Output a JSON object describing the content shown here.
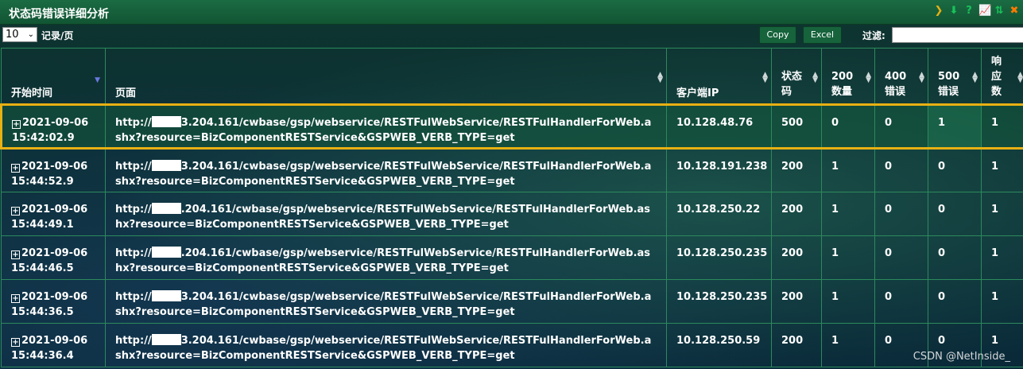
{
  "window": {
    "title": "状态码错误详细分析",
    "tools": [
      {
        "icon": "chevron-right-icon",
        "glyph": "❯",
        "color": "#e8b013"
      },
      {
        "icon": "download-icon",
        "glyph": "⬇",
        "color": "#19c25a"
      },
      {
        "icon": "help-icon",
        "glyph": "?",
        "color": "#19c25a"
      },
      {
        "icon": "line-chart-icon",
        "glyph": "📈",
        "color": "#19c25a"
      },
      {
        "icon": "sort-icon",
        "glyph": "⇅",
        "color": "#19c25a"
      },
      {
        "icon": "close-icon",
        "glyph": "✖",
        "color": "#ff7a00"
      }
    ]
  },
  "toolbar": {
    "page_size": "10",
    "per_page_label": "记录/页",
    "copy_label": "Copy",
    "excel_label": "Excel",
    "filter_label": "过滤:",
    "filter_value": ""
  },
  "table": {
    "columns": [
      {
        "key": "start_time",
        "label": "开始时间",
        "sort": "desc"
      },
      {
        "key": "page",
        "label": "页面",
        "sort": "both"
      },
      {
        "key": "client_ip",
        "label": "客户端IP",
        "sort": "both"
      },
      {
        "key": "status_code",
        "label": "状态码",
        "sort": "both"
      },
      {
        "key": "count_200",
        "label": "200数量",
        "sort": "both"
      },
      {
        "key": "err_400",
        "label": "400错误",
        "sort": "both"
      },
      {
        "key": "err_500",
        "label": "500错误",
        "sort": "both"
      },
      {
        "key": "resp_count",
        "label": "响应数",
        "sort": "both"
      }
    ],
    "rows": [
      {
        "date": "2021-09-06",
        "time": "15:42:02.9",
        "url_prefix": "http://",
        "url_rest": "3.204.161/cwbase/gsp/webservice/RESTFulWebService/RESTFulHandlerForWeb.ashx?resource=BizComponentRESTService&GSPWEB_VERB_TYPE=get",
        "client_ip": "10.128.48.76",
        "status_code": "500",
        "count_200": "0",
        "err_400": "0",
        "err_500": "1",
        "resp_count": "1",
        "selected": true
      },
      {
        "date": "2021-09-06",
        "time": "15:44:52.9",
        "url_prefix": "http://",
        "url_rest": "3.204.161/cwbase/gsp/webservice/RESTFulWebService/RESTFulHandlerForWeb.ashx?resource=BizComponentRESTService&GSPWEB_VERB_TYPE=get",
        "client_ip": "10.128.191.238",
        "status_code": "200",
        "count_200": "1",
        "err_400": "0",
        "err_500": "0",
        "resp_count": "1"
      },
      {
        "date": "2021-09-06",
        "time": "15:44:49.1",
        "url_prefix": "http://",
        "url_rest": ".204.161/cwbase/gsp/webservice/RESTFulWebService/RESTFulHandlerForWeb.ashx?resource=BizComponentRESTService&GSPWEB_VERB_TYPE=get",
        "client_ip": "10.128.250.22",
        "status_code": "200",
        "count_200": "1",
        "err_400": "0",
        "err_500": "0",
        "resp_count": "1"
      },
      {
        "date": "2021-09-06",
        "time": "15:44:46.5",
        "url_prefix": "http://",
        "url_rest": ".204.161/cwbase/gsp/webservice/RESTFulWebService/RESTFulHandlerForWeb.ashx?resource=BizComponentRESTService&GSPWEB_VERB_TYPE=get",
        "client_ip": "10.128.250.235",
        "status_code": "200",
        "count_200": "1",
        "err_400": "0",
        "err_500": "0",
        "resp_count": "1"
      },
      {
        "date": "2021-09-06",
        "time": "15:44:36.5",
        "url_prefix": "http://",
        "url_rest": "3.204.161/cwbase/gsp/webservice/RESTFulWebService/RESTFulHandlerForWeb.ashx?resource=BizComponentRESTService&GSPWEB_VERB_TYPE=get",
        "client_ip": "10.128.250.235",
        "status_code": "200",
        "count_200": "1",
        "err_400": "0",
        "err_500": "0",
        "resp_count": "1"
      },
      {
        "date": "2021-09-06",
        "time": "15:44:36.4",
        "url_prefix": "http://",
        "url_rest": "3.204.161/cwbase/gsp/webservice/RESTFulWebService/RESTFulHandlerForWeb.ashx?resource=BizComponentRESTService&GSPWEB_VERB_TYPE=get",
        "client_ip": "10.128.250.59",
        "status_code": "200",
        "count_200": "1",
        "err_400": "0",
        "err_500": "0",
        "resp_count": "1"
      }
    ]
  },
  "watermark": "CSDN @NetInside_",
  "colors": {
    "selected_border": "#e8b013",
    "title_bar": "#16633c",
    "grid_line": "#2c8a5c"
  }
}
